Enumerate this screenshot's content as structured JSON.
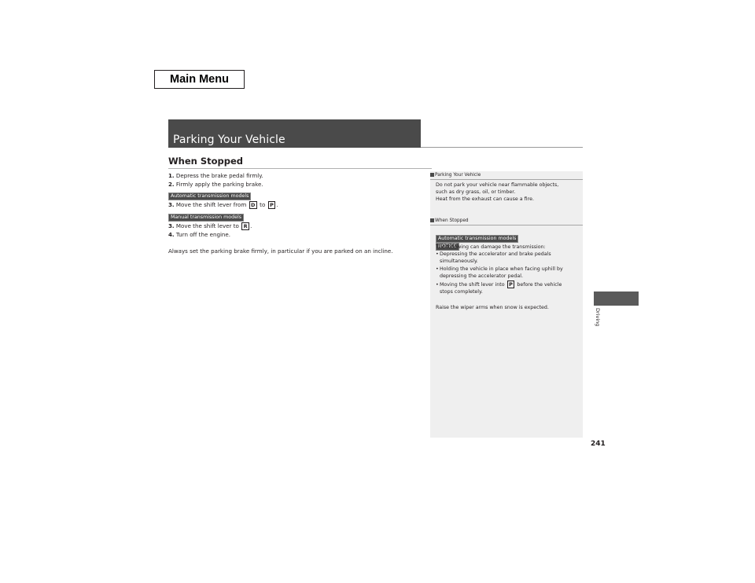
{
  "nav": {
    "main_menu_label": "Main Menu"
  },
  "section": {
    "title": "Parking Your Vehicle",
    "subtitle": "When Stopped"
  },
  "steps": {
    "step1": {
      "num": "1.",
      "text": "Depress the brake pedal firmly."
    },
    "step2": {
      "num": "2.",
      "text": "Firmly apply the parking brake."
    },
    "auto_tag": "Automatic transmission models",
    "step3_auto": {
      "num": "3.",
      "text_before": "Move the shift lever from",
      "key1": "D",
      "mid": "to",
      "key2": "P",
      "end": "."
    },
    "manual_tag": "Manual transmission models",
    "step3_manual": {
      "num": "3.",
      "text_before": "Move the shift lever to",
      "key": "R",
      "end": "."
    },
    "step4": {
      "num": "4.",
      "text": "Turn off the engine."
    },
    "note": "Always set the parking brake firmly, in particular if you are parked on an incline."
  },
  "sidebar": {
    "parking": {
      "heading": "Parking Your Vehicle",
      "lines": [
        "Do not park your vehicle near flammable objects,",
        "such as dry grass, oil, or timber.",
        "Heat from the exhaust can cause a fire."
      ]
    },
    "stopped": {
      "heading": "When Stopped",
      "tag": "Automatic transmission models",
      "notice": "NOTICE",
      "intro": "The following can damage the transmission:",
      "bullets": [
        {
          "line1": "Depressing the accelerator and brake pedals",
          "line2": "simultaneously."
        },
        {
          "line1": "Holding the vehicle in place when facing uphill by",
          "line2": "depressing the accelerator pedal."
        },
        {
          "line1_before": "Moving the shift lever into",
          "key": "P",
          "line1_after": "before the vehicle",
          "line2": "stops completely."
        }
      ],
      "footer": "Raise the wiper arms when snow is expected."
    }
  },
  "chapter_tab": {
    "label": "Driving"
  },
  "page_number": "241"
}
